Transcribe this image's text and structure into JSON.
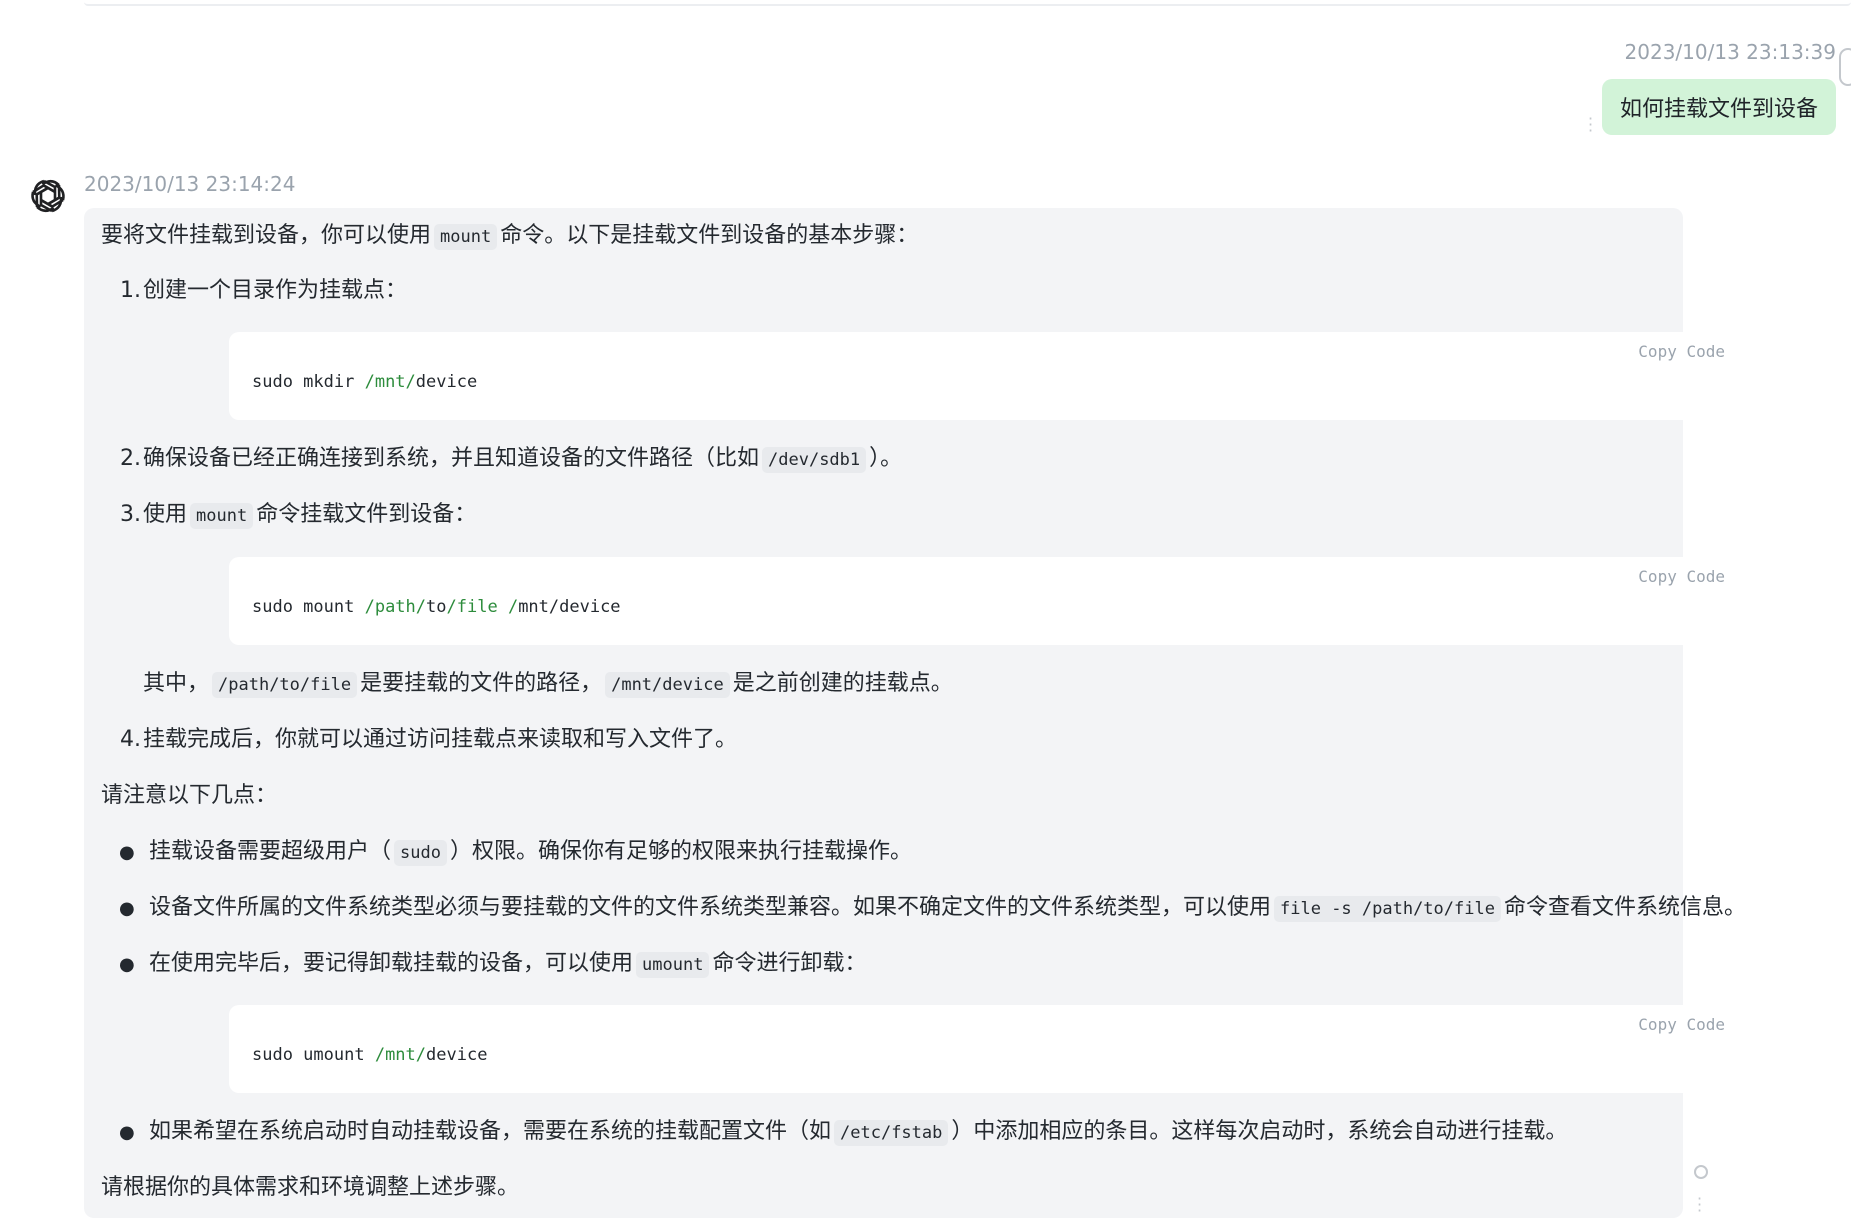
{
  "user_message": {
    "timestamp": "2023/10/13 23:13:39",
    "text": "如何挂载文件到设备"
  },
  "assistant_message": {
    "avatar_icon": "openai-logo-icon",
    "timestamp": "2023/10/13 23:14:24",
    "intro": {
      "pre": "要将文件挂载到设备，你可以使用",
      "code": "mount",
      "post": "命令。以下是挂载文件到设备的基本步骤："
    },
    "step1": {
      "num": "1.",
      "text": "创建一个目录作为挂载点："
    },
    "code1": {
      "copy": "Copy Code",
      "pre": "sudo mkdir ",
      "path": "/mnt/",
      "post": "device"
    },
    "step2": {
      "num": "2.",
      "pre": "确保设备已经正确连接到系统，并且知道设备的文件路径（比如",
      "code": "/dev/sdb1",
      "post": "）。"
    },
    "step3": {
      "num": "3.",
      "pre": "使用",
      "code": "mount",
      "post": "命令挂载文件到设备："
    },
    "code2": {
      "copy": "Copy Code",
      "pre": "sudo mount ",
      "path1": "/path/",
      "mid1": "to",
      "path2": "/file",
      "mid2": " ",
      "path3": "/",
      "post": "mnt/device"
    },
    "where": {
      "pre": "其中，",
      "code1": "/path/to/file",
      "mid": "是要挂载的文件的路径，",
      "code2": "/mnt/device",
      "post": "是之前创建的挂载点。"
    },
    "step4": {
      "num": "4.",
      "text": "挂载完成后，你就可以通过访问挂载点来读取和写入文件了。"
    },
    "notes_title": "请注意以下几点：",
    "bullet1": {
      "pre": "挂载设备需要超级用户（",
      "code": "sudo",
      "post": "）权限。确保你有足够的权限来执行挂载操作。"
    },
    "bullet2": {
      "pre": "设备文件所属的文件系统类型必须与要挂载的文件的文件系统类型兼容。如果不确定文件的文件系统类型，可以使用",
      "code": "file -s /path/to/file",
      "post": "命令查看文件系统信息。"
    },
    "bullet3": {
      "pre": "在使用完毕后，要记得卸载挂载的设备，可以使用",
      "code": "umount",
      "post": "命令进行卸载："
    },
    "code3": {
      "copy": "Copy Code",
      "pre": "sudo umount ",
      "path": "/mnt/",
      "post": "device"
    },
    "bullet4": {
      "pre": "如果希望在系统启动时自动挂载设备，需要在系统的挂载配置文件（如",
      "code": "/etc/fstab",
      "post": "）中添加相应的条目。这样每次启动时，系统会自动进行挂载。"
    },
    "closing": "请根据你的具体需求和环境调整上述步骤。"
  },
  "icons": {
    "user_menu": "vertical-dots-icon",
    "side_status": "loading-circle-icon",
    "side_menu": "vertical-dots-icon"
  }
}
